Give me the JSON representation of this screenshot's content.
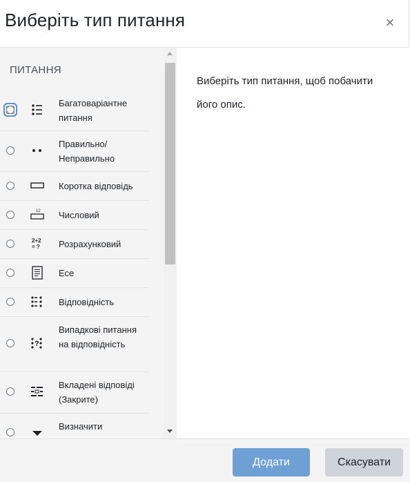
{
  "dialog": {
    "title": "Виберіть тип питання",
    "close_glyph": "×"
  },
  "left": {
    "section_title": "ПИТАННЯ",
    "options": [
      {
        "label": "Багатоваріантне питання",
        "icon": "multichoice-icon",
        "selected": false,
        "focused": true
      },
      {
        "label": "Правильно/ Неправильно",
        "icon": "truefalse-icon"
      },
      {
        "label": "Коротка відповідь",
        "icon": "shortanswer-icon"
      },
      {
        "label": "Числовий",
        "icon": "numerical-icon"
      },
      {
        "label": "Розрахунковий",
        "icon": "calculated-icon"
      },
      {
        "label": "Есе",
        "icon": "essay-icon"
      },
      {
        "label": "Відповідність",
        "icon": "match-icon"
      },
      {
        "label": "Випадкові питання на відповідність",
        "icon": "randomsamatch-icon"
      },
      {
        "label": "Вкладені відповіді (Закрите)",
        "icon": "multianswer-icon"
      },
      {
        "label": "Визначити",
        "icon": "ddwtos-icon"
      }
    ]
  },
  "right": {
    "description": "Виберіть тип питання, щоб побачити його опис."
  },
  "footer": {
    "add_label": "Додати",
    "cancel_label": "Скасувати"
  },
  "colors": {
    "primary": "#6ea0d6",
    "secondary": "#ced4da",
    "pane_bg": "#f4f4f4"
  }
}
